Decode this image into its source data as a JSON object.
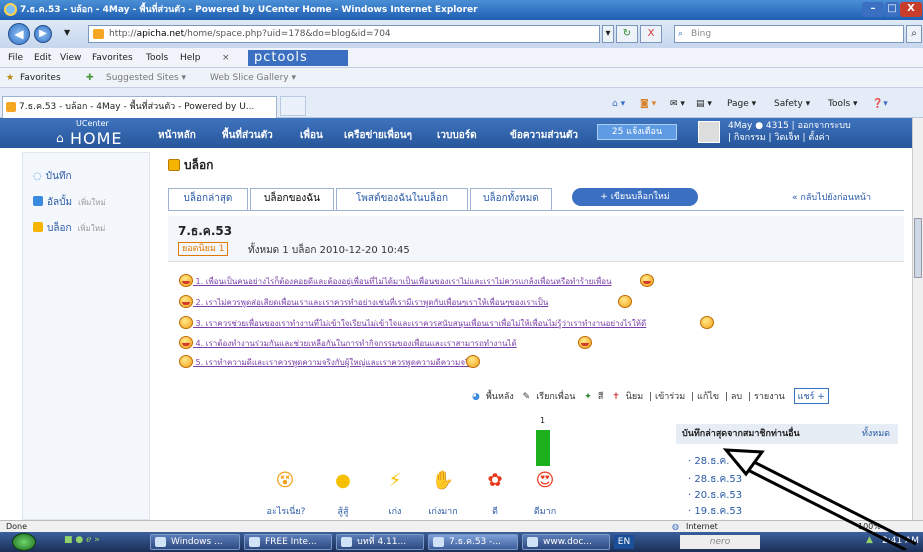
{
  "window": {
    "title": "7.ธ.ค.53 - บล้อก - 4May - พื้นที่ส่วนตัว - Powered by UCenter Home - Windows Internet Explorer",
    "minimize": "–",
    "close": "X"
  },
  "address": {
    "url_prefix": "http://",
    "url_domain": "apicha.net",
    "url_rest": "/home/space.php?uid=178&do=blog&id=704",
    "search_placeholder": "Bing",
    "refresh": "↻",
    "stop": "X",
    "toolbar_brand": "pctools"
  },
  "menu": [
    "File",
    "Edit",
    "View",
    "Favorites",
    "Tools",
    "Help"
  ],
  "favorites_bar": {
    "favorites": "Favorites",
    "suggested": "Suggested Sites ▾",
    "gallery": "Web Slice Gallery ▾"
  },
  "tab": {
    "title": "7.ธ.ค.53 - บล้อก - 4May - พื้นที่ส่วนตัว - Powered by U...",
    "commands": [
      "Page ▾",
      "Safety ▾",
      "Tools ▾"
    ]
  },
  "site": {
    "logo_small": "UCenter",
    "logo_big": "HOME",
    "nav": [
      "หน้าหลัก",
      "พื้นที่ส่วนตัว",
      "เพื่อน",
      "เครือข่ายเพื่อนๆ",
      "เวบบอร์ด",
      "ข้อความส่วนตัว"
    ],
    "notifications": "25 แจ้งเตือน",
    "user_line1": "4May  ● 4315  |  ออกจากระบบ",
    "user_line2": "|  กิจกรรม  |  วิดเจ็ท  |  ตั้งค่า"
  },
  "sidebar": {
    "items": [
      {
        "label": "บันทึก",
        "sub": ""
      },
      {
        "label": "อัลบั้ม",
        "sub": "เพิ่มใหม่"
      },
      {
        "label": "บล็อก",
        "sub": "เพิ่มใหม่"
      }
    ]
  },
  "page": {
    "title": "บล็อก",
    "tabs": [
      "บล็อกล่าสุด",
      "บล็อกของฉัน",
      "โพสต์ของฉันในบล็อก",
      "บล็อกทั้งหมด"
    ],
    "new_blog": "+ เขียนบล็อกใหม่",
    "back": "« กลับไปยังก่อนหน้า"
  },
  "post": {
    "title": "7.ธ.ค.53",
    "popular": "ยอดนิยม 1",
    "meta": "ทั้งหมด 1 บล็อก  2010-12-20 10:45",
    "lines": [
      "1. เพื่อนเป็นคนอย่างไรก็ต้องคอยดีและต้องอยู่เพื่อนที่ไม่ได้มาเป็นเพื่อนของเราไม่และเราไม่ควรแกล้งเพื่อนหรือทำร้ายเพื่อน",
      "2. เราไม่ควรพูดส่อเสียดเพื่อนเราและเราควรทำอย่างเช่นที่เรามีเราพูดกับเพื่อนๆเราให้เพื่อนๆของเราเป็น",
      "3. เราควรช่วยเพื่อนของเราทำงานที่ไม่เข้าใจเรียนไม่เข้าใจและเราควรสนับสนุนเพื่อนเราเพื่อไม่ให้เพื่อนไม่รู้ว่าเราทำงานอย่างไรให้ดี",
      "4. เราต้องทำงานร่วมกันและช่วยเหลือกันในการทำกิจกรรมของเพื่อนและเราสามารถทำงานได้",
      "5. เราทำความดีและเราควรพูดความจริงกับผู้ใหญ่และเราควรพูดความดีความจริง"
    ]
  },
  "actions": {
    "items": [
      "พื้นหลัง",
      "เรียกเพื่อน",
      "สี",
      "นิยม",
      "เข้าร่วม",
      "แก้ไข",
      "ลบ",
      "รายงาน"
    ],
    "share": "แชร์ +"
  },
  "votes": {
    "count": "1",
    "emotion_levels": [
      1,
      0,
      0,
      0,
      0,
      0
    ],
    "labels": [
      "อะไรเนี่ย?",
      "สู้สู้",
      "เก่ง",
      "เก่งมาก",
      "ดี",
      "ดีมาก"
    ]
  },
  "recent": {
    "heading": "บันทึกล่าสุดจากสมาชิกท่านอื่น",
    "all": "ทั้งหมด",
    "items": [
      "28.ธ.ค.",
      "28.ธ.ค.53",
      "20.ธ.ค.53",
      "19.ธ.ค.53"
    ]
  },
  "status": {
    "left": "Done",
    "zone": "Internet",
    "zoom": "100%"
  },
  "taskbar": {
    "items": [
      "Windows ...",
      "FREE Inte...",
      "บทที่ 4.11...",
      "7.ธ.ค.53 -...",
      "www.doc...",
      "EN"
    ],
    "brand": "nero",
    "clock": "2:41 AM"
  }
}
